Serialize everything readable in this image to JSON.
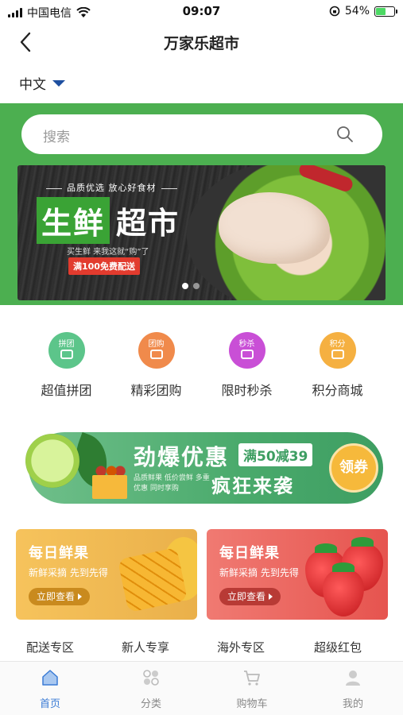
{
  "status_bar": {
    "carrier": "中国电信",
    "time": "09:07",
    "battery": "54%"
  },
  "nav": {
    "title": "万家乐超市"
  },
  "language": {
    "selected": "中文"
  },
  "search": {
    "placeholder": "搜索"
  },
  "banner": {
    "tagline": "品质优选 放心好食材",
    "title_a": "生鲜",
    "title_b": "超市",
    "subtitle": "买生鲜 来我这就“购”了",
    "badge": "满100免费配送"
  },
  "features": [
    {
      "icon_text": "拼团",
      "label": "超值拼团",
      "color": "#5cc58a"
    },
    {
      "icon_text": "团购",
      "label": "精彩团购",
      "color": "#f08a4b"
    },
    {
      "icon_text": "秒杀",
      "label": "限时秒杀",
      "color": "#c94fd6"
    },
    {
      "icon_text": "积分",
      "label": "积分商城",
      "color": "#f5b041"
    }
  ],
  "promo": {
    "title": "劲爆优惠",
    "tag": "满50减39",
    "small_text": "品质鲜果 低价尝鲜 多重优惠 同时享购",
    "subtitle": "疯狂来袭",
    "coupon": "领券"
  },
  "cards": [
    {
      "title": "每日鲜果",
      "subtitle": "新鲜采摘 先到先得",
      "button": "立即查看",
      "color_from": "#f6c35c",
      "color_to": "#eab04a",
      "btn_color": "#c98a1e"
    },
    {
      "title": "每日鲜果",
      "subtitle": "新鲜采摘 先到先得",
      "button": "立即查看",
      "color_from": "#f07a72",
      "color_to": "#e6544f",
      "btn_color": "#b83a35"
    }
  ],
  "quick_links": [
    "配送专区",
    "新人专享",
    "海外专区",
    "超级红包"
  ],
  "tabbar": [
    {
      "label": "首页",
      "icon": "home-icon",
      "active": true
    },
    {
      "label": "分类",
      "icon": "category-icon",
      "active": false
    },
    {
      "label": "购物车",
      "icon": "cart-icon",
      "active": false
    },
    {
      "label": "我的",
      "icon": "user-icon",
      "active": false
    }
  ],
  "colors": {
    "accent_green": "#4caf50",
    "tab_active": "#3a7bd5"
  }
}
